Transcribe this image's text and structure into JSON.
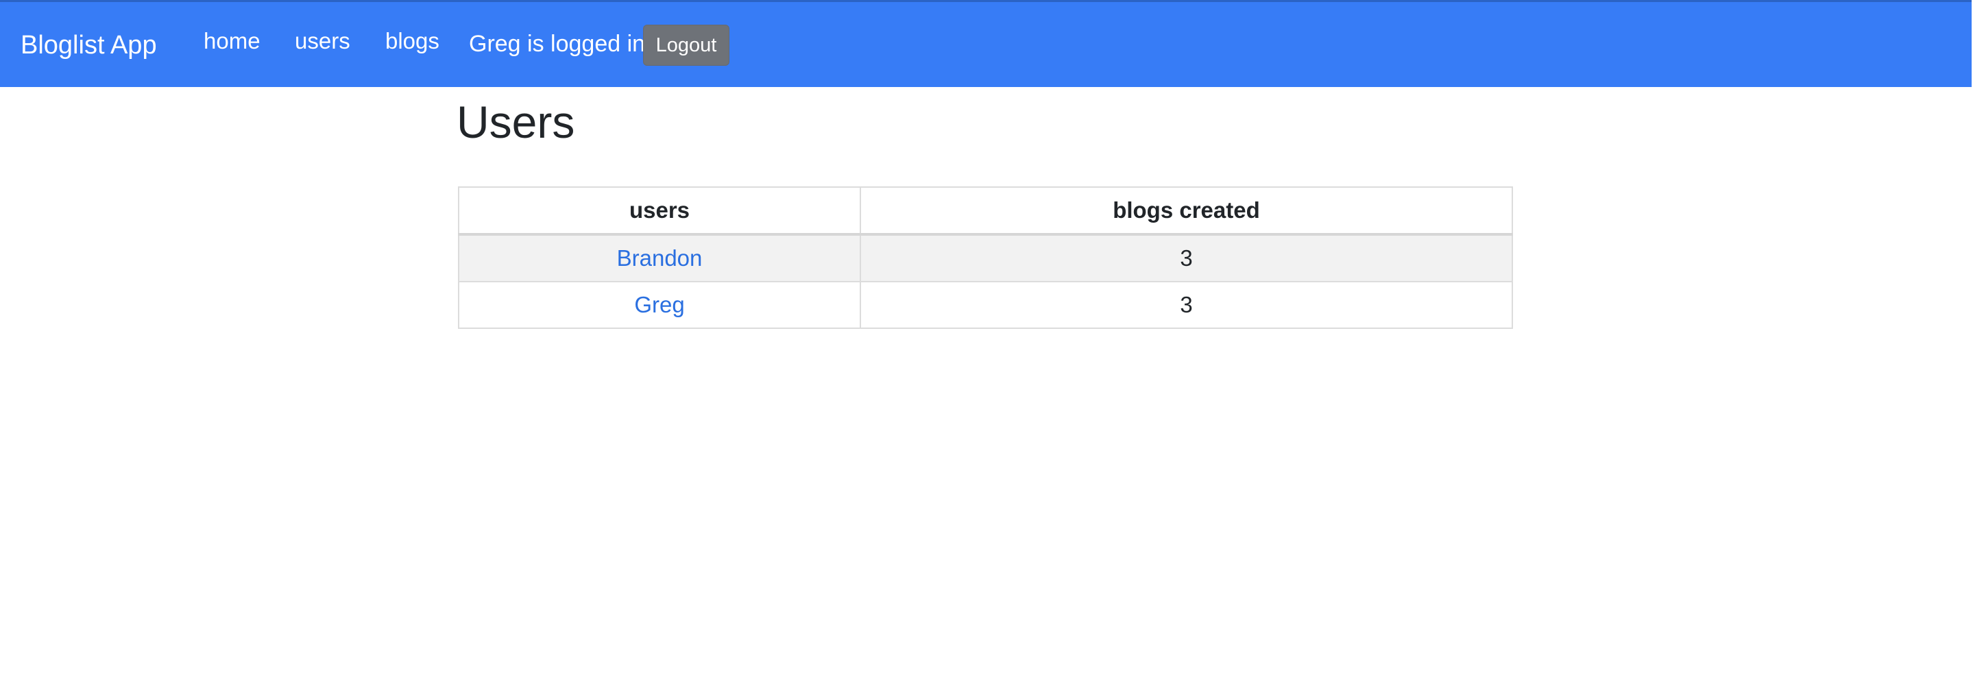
{
  "navbar": {
    "brand": "Bloglist App",
    "links": {
      "home": "home",
      "users": "users",
      "blogs": "blogs"
    },
    "login_status": "Greg is logged in",
    "logout_label": "Logout",
    "background_color": "#377cf6"
  },
  "page": {
    "title": "Users"
  },
  "users_table": {
    "headers": {
      "users": "users",
      "blogs_created": "blogs created"
    },
    "rows": [
      {
        "name": "Brandon",
        "blogs_created": "3"
      },
      {
        "name": "Greg",
        "blogs_created": "3"
      }
    ]
  },
  "colors": {
    "link": "#2a6fe0",
    "striped_row": "#f2f2f2",
    "logout_button": "#6e7278"
  }
}
